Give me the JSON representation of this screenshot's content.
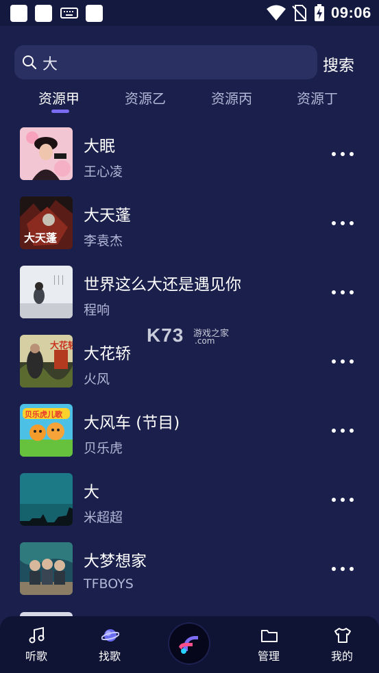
{
  "status_bar": {
    "time": "09:06",
    "icons": [
      "notification-square-icon",
      "notification-square-icon",
      "keyboard-icon",
      "notification-square-icon",
      "wifi-icon",
      "no-sim-icon",
      "battery-charging-icon"
    ]
  },
  "search": {
    "value": "大",
    "button_label": "搜索",
    "icon": "search-icon"
  },
  "tabs": [
    {
      "label": "资源甲",
      "active": true
    },
    {
      "label": "资源乙",
      "active": false
    },
    {
      "label": "资源丙",
      "active": false
    },
    {
      "label": "资源丁",
      "active": false
    }
  ],
  "songs": [
    {
      "title": "大眠",
      "artist": "王心凌",
      "cover_text": ""
    },
    {
      "title": "大天蓬",
      "artist": "李袁杰",
      "cover_text": "大天蓬"
    },
    {
      "title": "世界这么大还是遇见你",
      "artist": "程响",
      "cover_text": ""
    },
    {
      "title": "大花轿",
      "artist": "火风",
      "cover_text": "大花轿"
    },
    {
      "title": "大风车 (节目)",
      "artist": "贝乐虎",
      "cover_text": "贝乐虎儿歌"
    },
    {
      "title": "大",
      "artist": "米超超",
      "cover_text": ""
    },
    {
      "title": "大梦想家",
      "artist": "TFBOYS",
      "cover_text": ""
    }
  ],
  "watermark": {
    "brand": "K73",
    "text": "游戏之家",
    "domain": ".com"
  },
  "bottom_nav": {
    "items": [
      {
        "label": "听歌",
        "icon": "music-note-icon"
      },
      {
        "label": "找歌",
        "icon": "planet-icon"
      },
      {
        "label": "管理",
        "icon": "folder-icon"
      },
      {
        "label": "我的",
        "icon": "shirt-icon"
      }
    ],
    "center_icon": "app-logo-icon"
  },
  "colors": {
    "background": "#1a1f4b",
    "accent": "#7b6cf3",
    "nav_background": "#0f1334",
    "search_background": "#2a3062"
  }
}
